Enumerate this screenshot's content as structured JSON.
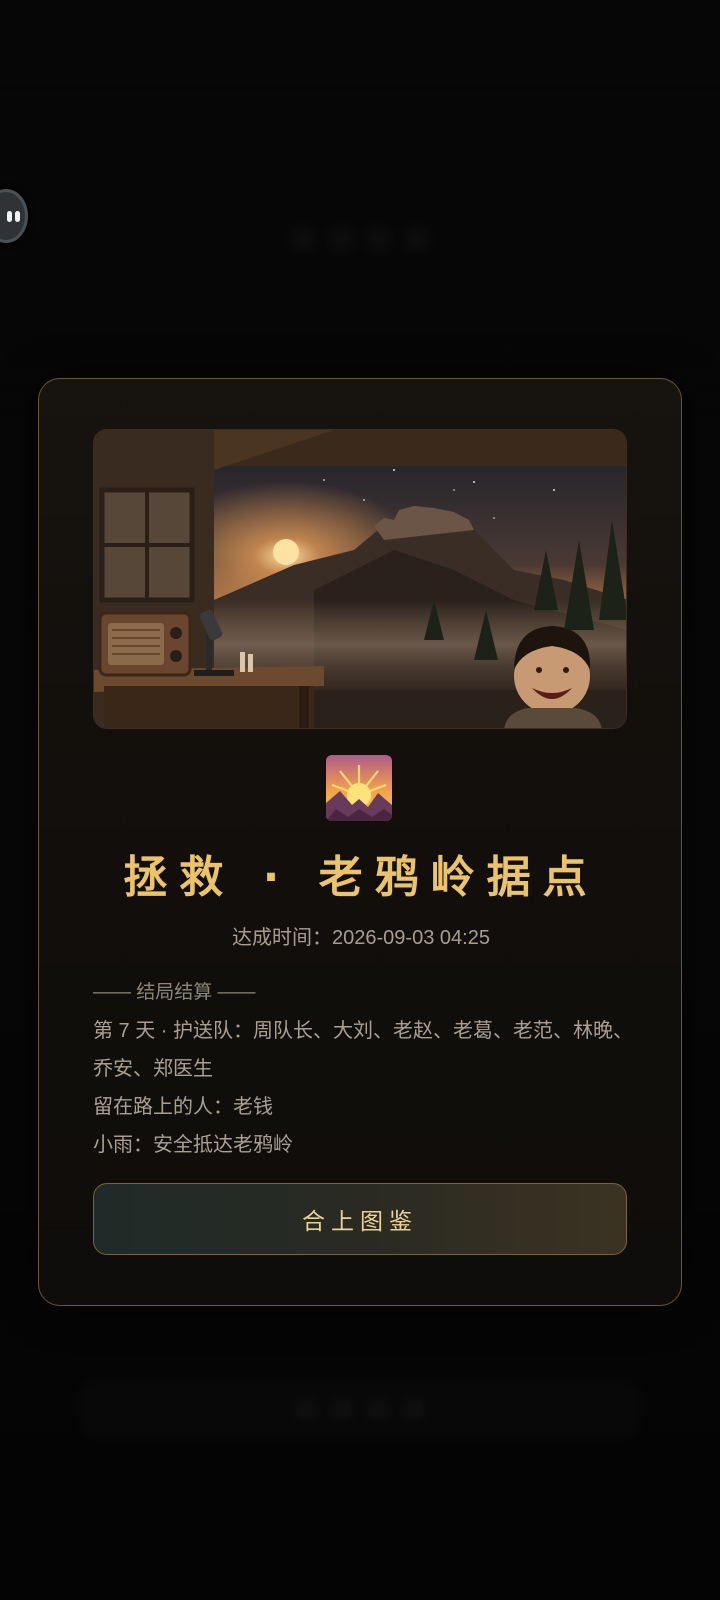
{
  "ending": {
    "title": "拯救 · 老鸦岭据点",
    "achieved_time": "达成时间：2026-09-03 04:25",
    "section_label": "—— 结局结算 ——",
    "summary_lines": [
      "第 7 天 · 护送队：周队长、大刘、老赵、老葛、老范、林晚、乔安、郑医生",
      "留在路上的人：老钱",
      "小雨：安全抵达老鸦岭"
    ],
    "close_button_label": "合上图鉴",
    "badge_icon": "sunrise-mountain-icon",
    "colors": {
      "title_gold": "#ebc36b",
      "card_border": "#6b5430",
      "button_text": "#ecd29a"
    }
  }
}
